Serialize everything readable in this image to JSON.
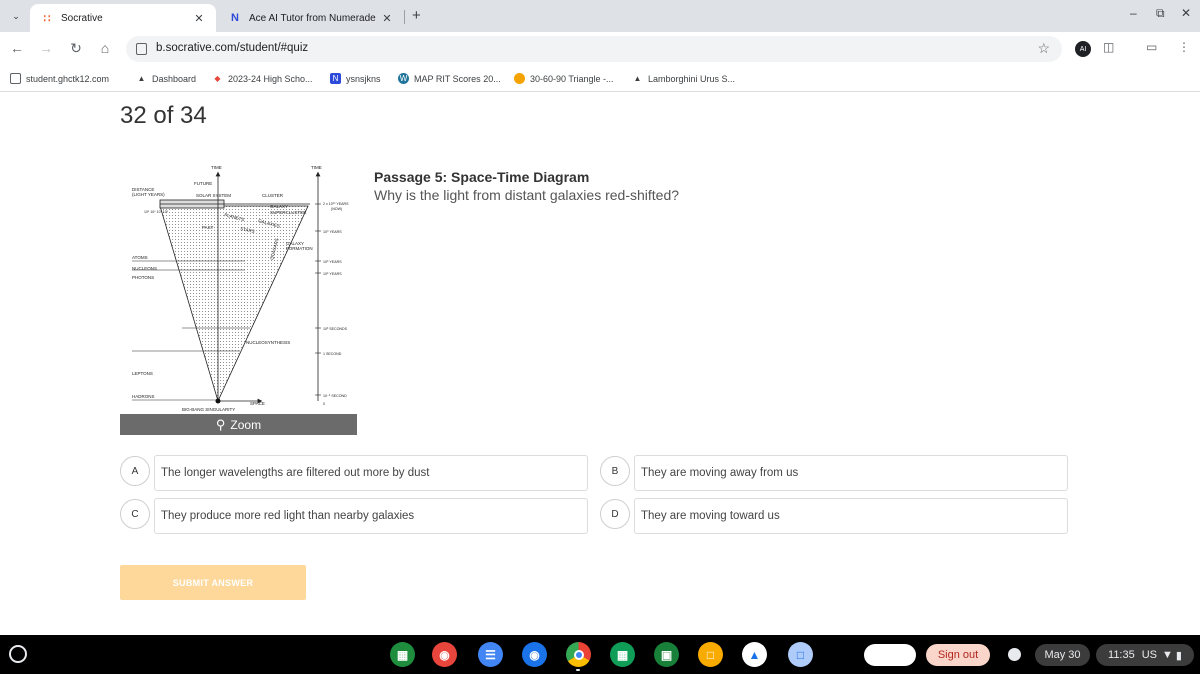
{
  "browser": {
    "tabs": [
      {
        "title": "Socrative",
        "active": true
      },
      {
        "title": "Ace AI Tutor from Numerade",
        "active": false
      }
    ],
    "url": "b.socrative.com/student/#quiz",
    "bookmarks": [
      "student.ghctk12.com",
      "Dashboard",
      "2023-24 High Scho...",
      "ysnsjkns",
      "MAP RIT Scores 20...",
      "30-60-90 Triangle -...",
      "Lamborghini Urus S..."
    ]
  },
  "quiz": {
    "progress": "32 of 34",
    "zoom_label": "Zoom",
    "passage_title": "Passage 5: Space-Time Diagram",
    "question": "Why is the light from distant galaxies red-shifted?",
    "choices": [
      {
        "letter": "A",
        "text": "The longer wavelengths are filtered out more by dust"
      },
      {
        "letter": "B",
        "text": "They are moving away from us"
      },
      {
        "letter": "C",
        "text": "They produce more red light than nearby galaxies"
      },
      {
        "letter": "D",
        "text": "They are moving toward us"
      }
    ],
    "submit_label": "SUBMIT ANSWER"
  },
  "diagram": {
    "labels": {
      "time_left": "TIME",
      "time_right": "TIME",
      "future": "FUTURE",
      "distance": "DISTANCE",
      "light_years": "(LIGHT YEARS)",
      "solar_system": "SOLAR SYSTEM",
      "cluster": "CLUSTER",
      "planets": "PLANETS",
      "galaxy": "GALAXY",
      "supercluster": "SUPERCLUSTER",
      "galaxies": "GALAXIES",
      "past": "PAST",
      "stars": "STARS",
      "quasars": "QUASARS",
      "galaxy_formation_1": "GALAXY",
      "galaxy_formation_2": "FORMATION",
      "atoms": "ATOMS",
      "nucleons": "NUCLEONS",
      "photons": "PHOTONS",
      "nucleosynthesis": "NUCLEOSYNTHESIS",
      "leptons": "LEPTONS",
      "hadrons": "HADRONS",
      "space": "SPACE",
      "big_bang": "BIG-BANG SINGULARITY",
      "now_1": "2 x 10¹⁰ YEARS",
      "now_2": "(NOW)",
      "t1": "10⁹ YEARS",
      "t2": "10⁶ YEARS",
      "t3": "10⁵ YEARS",
      "t4": "10³ SECONDS",
      "t5": "1 SECOND",
      "t6": "10⁻⁶ SECOND",
      "t7": "0",
      "scale": "10⁵ 10⁶ 10⁷ 10⁸"
    }
  },
  "shelf": {
    "sign_out": "Sign out",
    "date": "May 30",
    "time": "11:35",
    "locale": "US"
  }
}
